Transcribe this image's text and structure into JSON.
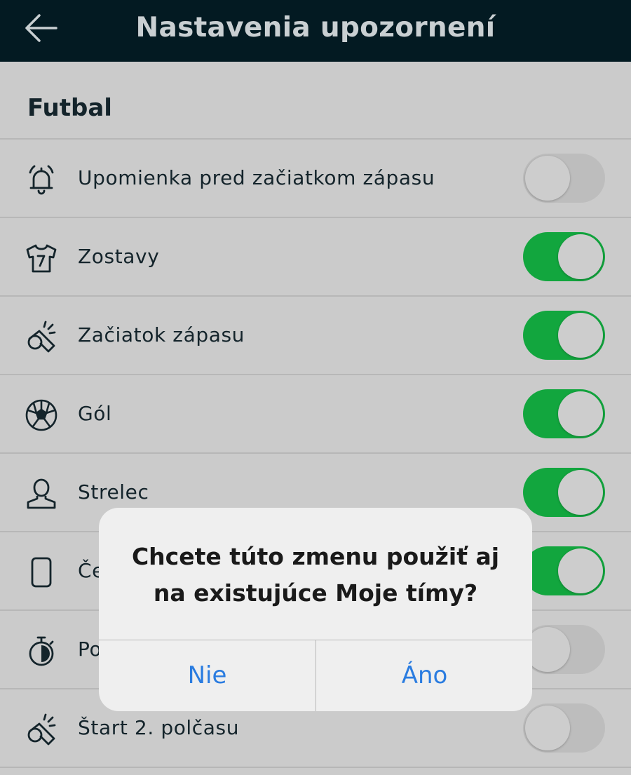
{
  "header": {
    "title": "Nastavenia upozornení",
    "back_icon": "back-arrow-icon"
  },
  "section": {
    "title": "Futbal"
  },
  "rows": [
    {
      "label": "Upomienka pred začiatkom zápasu",
      "icon": "bell-icon",
      "on": false
    },
    {
      "label": "Zostavy",
      "icon": "jersey-icon",
      "on": true
    },
    {
      "label": "Začiatok zápasu",
      "icon": "whistle-icon",
      "on": true
    },
    {
      "label": "Gól",
      "icon": "soccer-ball-icon",
      "on": true
    },
    {
      "label": "Strelec",
      "icon": "person-icon",
      "on": true
    },
    {
      "label": "Če",
      "icon": "card-icon",
      "on": true
    },
    {
      "label": "Po",
      "icon": "stopwatch-icon",
      "on": false
    },
    {
      "label": "Štart 2. polčasu",
      "icon": "whistle-icon",
      "on": false
    }
  ],
  "dialog": {
    "message_line1": "Chcete túto zmenu použiť aj",
    "message_line2": "na existujúce Moje tímy?",
    "no_label": "Nie",
    "yes_label": "Áno"
  },
  "colors": {
    "header_bg": "#031a22",
    "toggle_on": "#12a63e",
    "toggle_off": "#bdbdbd",
    "dialog_button": "#2a7ce0"
  }
}
